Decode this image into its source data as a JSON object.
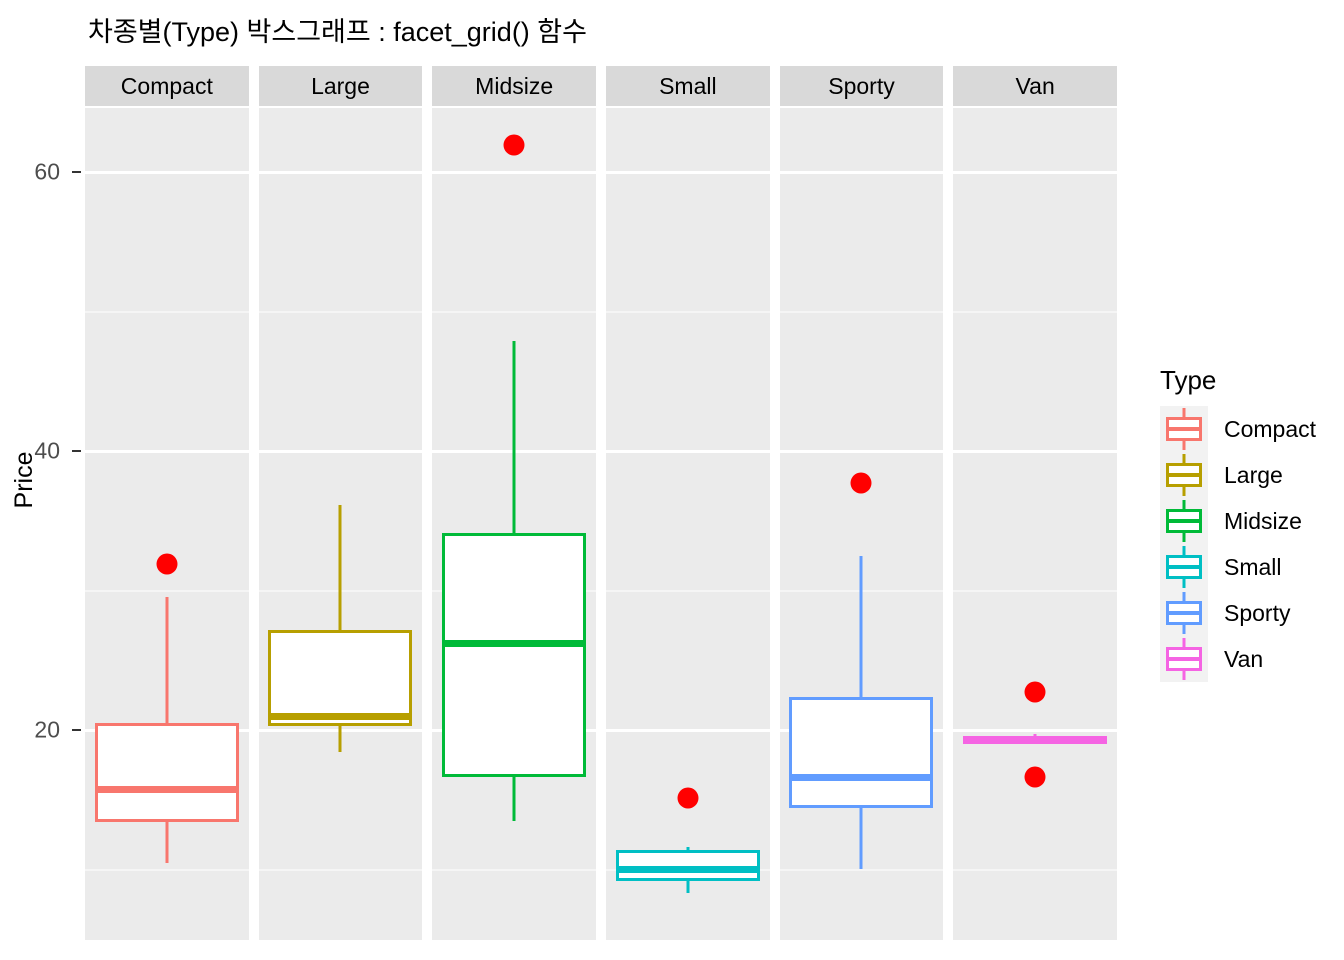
{
  "title": "차종별(Type) 박스그래프 : facet_grid() 함수",
  "axis": {
    "y_title": "Price",
    "y_ticks": [
      "60",
      "40",
      "20"
    ]
  },
  "legend": {
    "title": "Type",
    "items": [
      {
        "label": "Compact",
        "color": "#F8766D"
      },
      {
        "label": "Large",
        "color": "#B79F00"
      },
      {
        "label": "Midsize",
        "color": "#00BA38"
      },
      {
        "label": "Small",
        "color": "#00BFC4"
      },
      {
        "label": "Sporty",
        "color": "#619CFF"
      },
      {
        "label": "Van",
        "color": "#F564E3"
      }
    ]
  },
  "chart_data": {
    "type": "box",
    "title": "차종별(Type) 박스그래프 : facet_grid() 함수",
    "xlabel": "",
    "ylabel": "Price",
    "ylim": [
      6.5,
      64.5
    ],
    "grid": true,
    "grid_major": [
      20,
      40,
      60
    ],
    "grid_minor": [
      10,
      30,
      50
    ],
    "legend_position": "right",
    "legend_title": "Type",
    "facet_type": "facet_grid",
    "facets": [
      "Compact",
      "Large",
      "Midsize",
      "Small",
      "Sporty",
      "Van"
    ],
    "outlier_color": "#FF0000",
    "series": [
      {
        "name": "Compact",
        "color": "#F8766D",
        "lower_whisker": 10.5,
        "q1": 13.4,
        "median": 15.7,
        "q3": 20.5,
        "upper_whisker": 29.5,
        "outliers": [
          31.9
        ]
      },
      {
        "name": "Large",
        "color": "#B79F00",
        "lower_whisker": 18.4,
        "q1": 20.3,
        "median": 21.0,
        "q3": 27.2,
        "upper_whisker": 36.1,
        "outliers": []
      },
      {
        "name": "Midsize",
        "color": "#00BA38",
        "lower_whisker": 13.5,
        "q1": 16.6,
        "median": 26.2,
        "q3": 34.1,
        "upper_whisker": 47.9,
        "outliers": [
          61.9
        ]
      },
      {
        "name": "Small",
        "color": "#00BFC4",
        "lower_whisker": 8.3,
        "q1": 9.2,
        "median": 10.0,
        "q3": 11.4,
        "upper_whisker": 11.6,
        "outliers": [
          15.1
        ]
      },
      {
        "name": "Sporty",
        "color": "#619CFF",
        "lower_whisker": 10.0,
        "q1": 14.4,
        "median": 16.6,
        "q3": 22.4,
        "upper_whisker": 32.5,
        "outliers": [
          37.7
        ]
      },
      {
        "name": "Van",
        "color": "#F564E3",
        "lower_whisker": 19.0,
        "q1": 19.1,
        "median": 19.3,
        "q3": 19.5,
        "upper_whisker": 19.7,
        "outliers": [
          22.7,
          16.6
        ]
      }
    ]
  }
}
